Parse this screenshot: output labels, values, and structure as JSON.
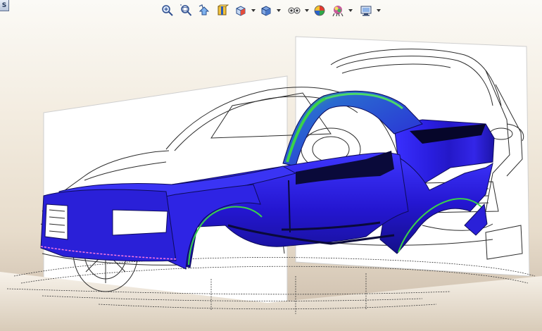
{
  "window": {
    "corner_tab_label": "S"
  },
  "toolbar": {
    "items": [
      {
        "name": "zoom-to-fit-icon",
        "has_dropdown": false
      },
      {
        "name": "zoom-to-area-icon",
        "has_dropdown": false
      },
      {
        "name": "previous-view-icon",
        "has_dropdown": false
      },
      {
        "name": "section-view-icon",
        "has_dropdown": false
      },
      {
        "name": "view-orientation-icon",
        "has_dropdown": true
      },
      {
        "name": "display-style-icon",
        "has_dropdown": true
      },
      {
        "name": "hide-show-items-icon",
        "has_dropdown": true
      },
      {
        "name": "edit-appearance-icon",
        "has_dropdown": false
      },
      {
        "name": "apply-scene-icon",
        "has_dropdown": true
      },
      {
        "name": "view-settings-icon",
        "has_dropdown": true
      }
    ]
  },
  "scene": {
    "model_description_icon": "car-body-surface-model",
    "colors": {
      "body_blue": "#2a20d8",
      "body_dark": "#0a0a3a",
      "curvature_green": "#3ad24a",
      "sketch_line": "#2b2b2b",
      "plane_fill": "#ffffff"
    }
  }
}
